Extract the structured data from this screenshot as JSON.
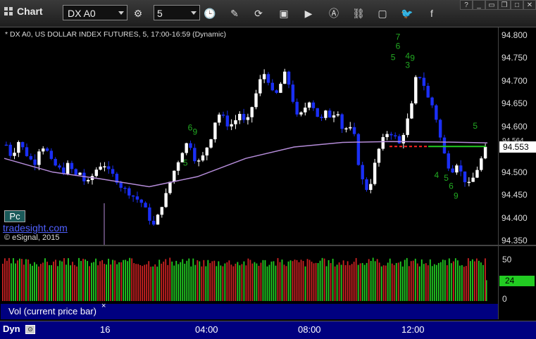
{
  "toolbar": {
    "title": "Chart",
    "symbol": "DX A0",
    "interval": "5",
    "icons": [
      "grid-icon",
      "settings-icon",
      "clock-icon",
      "pencil-icon",
      "cycle-icon",
      "cube-icon",
      "play-icon",
      "alert-icon",
      "link-icon",
      "chat-icon",
      "twitter-icon",
      "facebook-icon"
    ]
  },
  "chart_title": "* DX A0, US DOLLAR INDEX FUTURES, 5, 17:00-16:59 (Dynamic)",
  "badge": "Pc",
  "brand": "tradesight.com",
  "copyright": "© eSignal, 2015",
  "price_tag": "94.553",
  "price_tag_small": "94.564",
  "volume_panel": {
    "label": "Vol (current price bar)",
    "close": "×",
    "axis_labels": [
      "50",
      "25",
      "0"
    ],
    "current": "24"
  },
  "time_axis": {
    "mode": "Dyn",
    "labels": [
      "16",
      "04:00",
      "08:00",
      "12:00"
    ]
  },
  "colors": {
    "up_bar": "#ffffff",
    "down_bar": "#1a2ff5",
    "moving_average": "#b58cd9",
    "green_marks": "#22aa22",
    "red_line": "#ff2222",
    "green_line": "#22cc22",
    "vol_up": "#22cc22",
    "vol_down": "#cc2222"
  },
  "chart_data": [
    {
      "type": "candlestick",
      "title": "DX A0, US DOLLAR INDEX FUTURES, 5, 17:00-16:59 (Dynamic)",
      "ylim": [
        94.35,
        94.8
      ],
      "y_ticks": [
        "94.800",
        "94.750",
        "94.700",
        "94.650",
        "94.600",
        "94.550",
        "94.500",
        "94.450",
        "94.400",
        "94.350"
      ],
      "x_tick_labels": [
        "16",
        "04:00",
        "08:00",
        "12:00"
      ],
      "close_path": [
        94.56,
        94.53,
        94.57,
        94.55,
        94.53,
        94.52,
        94.56,
        94.55,
        94.52,
        94.51,
        94.5,
        94.52,
        94.49,
        94.5,
        94.47,
        94.49,
        94.51,
        94.52,
        94.5,
        94.49,
        94.47,
        94.46,
        94.45,
        94.44,
        94.43,
        94.4,
        94.38,
        94.42,
        94.45,
        94.49,
        94.52,
        94.55,
        94.57,
        94.53,
        94.52,
        94.55,
        94.58,
        94.63,
        94.62,
        94.6,
        94.61,
        94.63,
        94.6,
        94.64,
        94.68,
        94.72,
        94.7,
        94.66,
        94.69,
        94.72,
        94.67,
        94.62,
        94.63,
        94.66,
        94.64,
        94.61,
        94.63,
        94.62,
        94.64,
        94.59,
        94.6,
        94.58,
        94.5,
        94.46,
        94.48,
        94.54,
        94.57,
        94.59,
        94.58,
        94.56,
        94.6,
        94.64,
        94.72,
        94.7,
        94.66,
        94.64,
        94.58,
        94.53,
        94.5,
        94.52,
        94.49,
        94.47,
        94.49,
        94.52,
        94.55
      ],
      "moving_average": [
        {
          "t": 0.0,
          "v": 94.53
        },
        {
          "t": 0.1,
          "v": 94.5
        },
        {
          "t": 0.2,
          "v": 94.485
        },
        {
          "t": 0.3,
          "v": 94.468
        },
        {
          "t": 0.4,
          "v": 94.49
        },
        {
          "t": 0.5,
          "v": 94.53
        },
        {
          "t": 0.6,
          "v": 94.555
        },
        {
          "t": 0.7,
          "v": 94.565
        },
        {
          "t": 0.8,
          "v": 94.567
        },
        {
          "t": 0.9,
          "v": 94.566
        },
        {
          "t": 1.0,
          "v": 94.564
        }
      ],
      "red_level": 94.553,
      "green_level": 94.553,
      "sequence_marks": [
        {
          "text": "7",
          "t": 0.81,
          "v": 94.79
        },
        {
          "text": "6",
          "t": 0.81,
          "v": 94.77
        },
        {
          "text": "5",
          "t": 0.8,
          "v": 94.745
        },
        {
          "text": "4",
          "t": 0.83,
          "v": 94.748
        },
        {
          "text": "3",
          "t": 0.83,
          "v": 94.728
        },
        {
          "text": "9",
          "t": 0.84,
          "v": 94.744
        },
        {
          "text": "6",
          "t": 0.38,
          "v": 94.591
        },
        {
          "text": "9",
          "t": 0.39,
          "v": 94.582
        },
        {
          "text": "5",
          "t": 0.37,
          "v": 94.514
        },
        {
          "text": "5",
          "t": 0.97,
          "v": 94.595
        },
        {
          "text": "4",
          "t": 0.89,
          "v": 94.487
        },
        {
          "text": "5",
          "t": 0.91,
          "v": 94.481
        },
        {
          "text": "6",
          "t": 0.92,
          "v": 94.463
        },
        {
          "text": "9",
          "t": 0.93,
          "v": 94.442
        }
      ]
    },
    {
      "type": "bar",
      "title": "Vol (current price bar)",
      "ylim": [
        0,
        60
      ],
      "y_ticks": [
        "50",
        "25",
        "0"
      ],
      "current_value": 24
    }
  ]
}
